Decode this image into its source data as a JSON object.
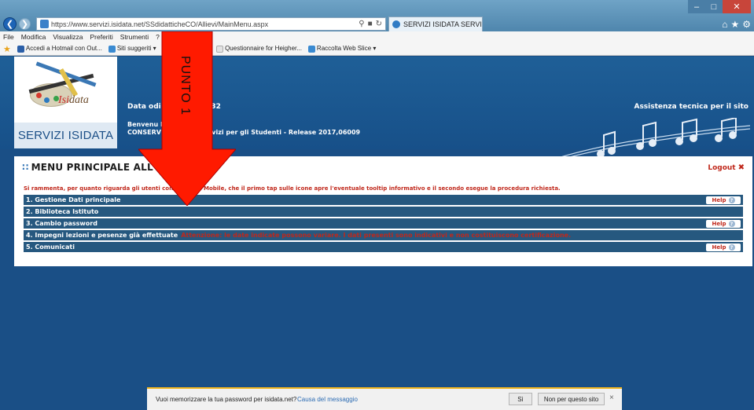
{
  "browser": {
    "url": "https://www.servizi.isidata.net/SSdidatticheCO/Allievi/MainMenu.aspx",
    "tab_title": "SERVIZI ISIDATA SERVIZI IS...",
    "menu": [
      "File",
      "Modifica",
      "Visualizza",
      "Preferiti",
      "Strumenti",
      "?"
    ],
    "favorites": [
      "Accedi a Hotmail con Out...",
      "Siti suggeriti ▾",
      "b",
      "Questionnaire for Heigher...",
      "Raccolta Web Slice ▾"
    ]
  },
  "header": {
    "brand": "SERVIZI ISIDATA",
    "logo_text_isi": "Isi",
    "logo_text_rest": "data",
    "date": "Data odi                              2017 11:06:32",
    "assist": "Assistenza tecnica per il sito",
    "welcome_line1": "Benvenu                        Marco",
    "welcome_line2": "CONSERV                    VERONA - Servizi per gli Studenti - Release 2017,06009"
  },
  "main": {
    "title": "MENU PRINCIPALE ALL                  COLATI",
    "logout": "Logout",
    "notice": "Si rammenta, per quanto riguarda gli utenti con               er Safari Mobile, che il primo tap sulle icone apre l'eventuale tooltip informativo e il secondo esegue la procedura richiesta.",
    "items": [
      {
        "label": "1. Gestione Dati principale",
        "help": "Help"
      },
      {
        "label": "2. Biblioteca Istituto"
      },
      {
        "label": "3. Cambio password",
        "help": "Help"
      },
      {
        "label": "4. Impegni lezioni e pesenze già effettuate",
        "extra": "Attenzione: le date indicate possono variare. I dati presenti sono indicativi e non costituiscono certificazione."
      },
      {
        "label": "5. Comunicati",
        "help": "Help"
      }
    ]
  },
  "annotation": {
    "label": "PUNTO 1"
  },
  "password_bar": {
    "message": "Vuoi memorizzare la tua password per isidata.net?",
    "cause": "Causa del messaggio",
    "yes": "Sì",
    "no": "Non per questo sito"
  },
  "colors": {
    "header_blue": "#1f5f97",
    "row_blue": "#26587f",
    "red": "#c0281b",
    "arrow_red": "#ff0000"
  },
  "icons": {
    "back": "arrow-left-icon",
    "forward": "arrow-right-icon",
    "home": "home-icon",
    "favorites": "star-icon",
    "settings": "gear-icon"
  }
}
